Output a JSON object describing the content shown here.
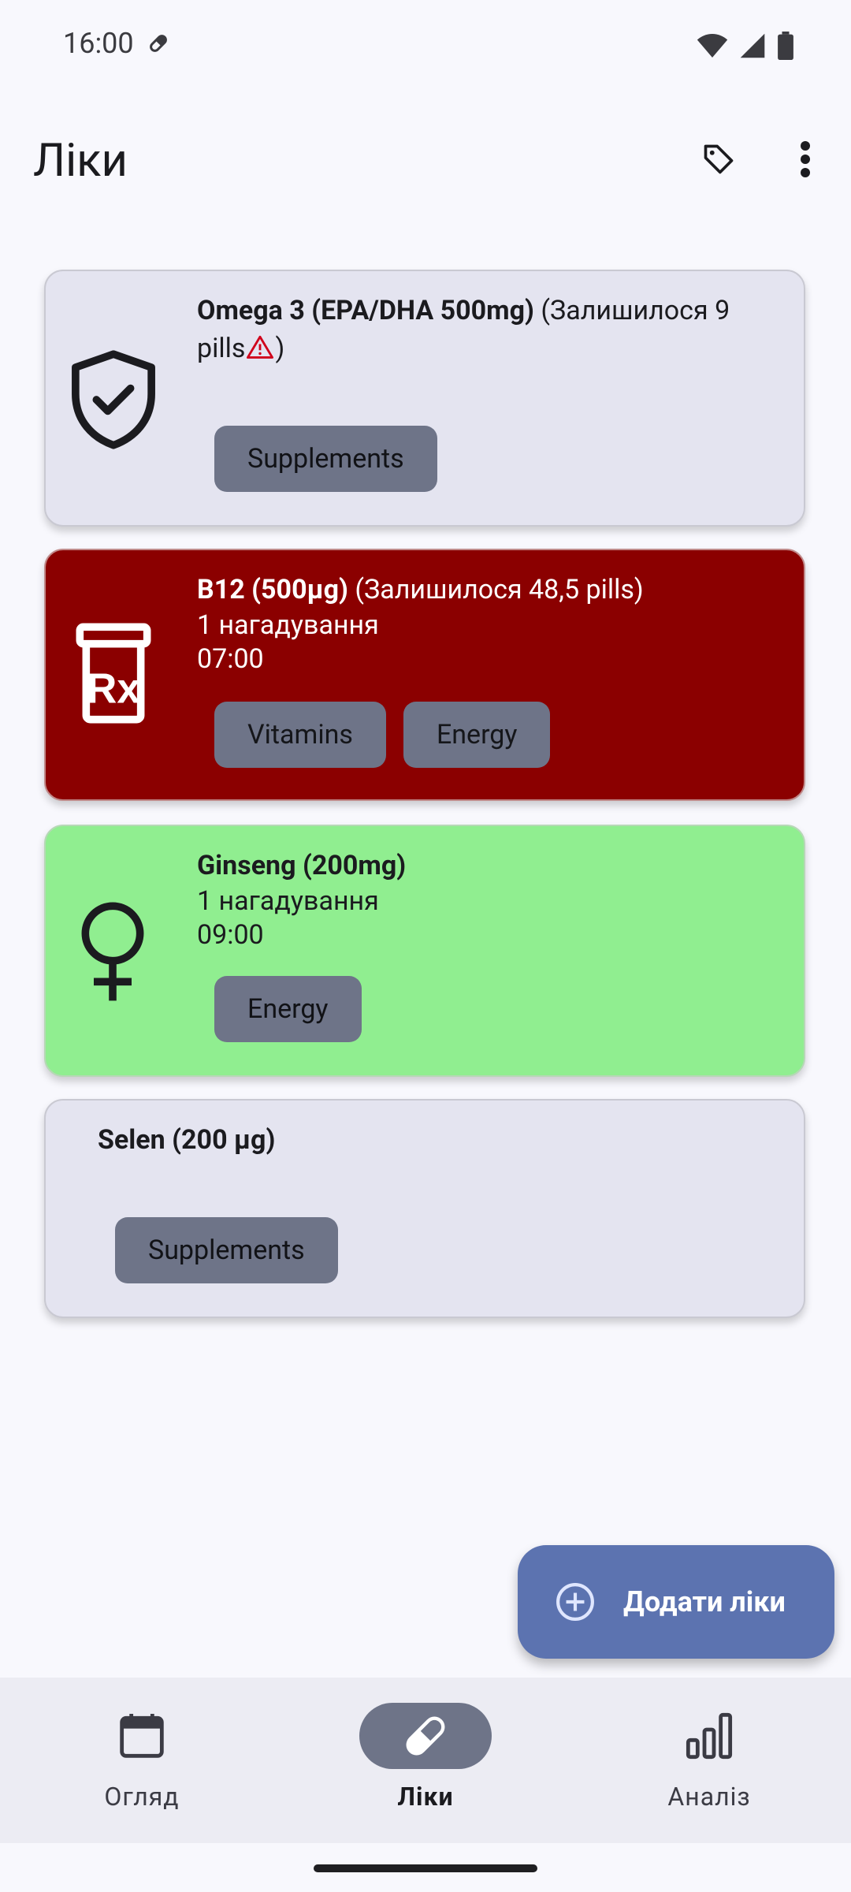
{
  "status_bar": {
    "time": "16:00"
  },
  "app_bar": {
    "title": "Ліки"
  },
  "medicines": [
    {
      "name": "Omega 3 (EPA/DHA 500mg)",
      "stock": "(Залишилося 9",
      "stock_unit": "pills",
      "stock_close": ")",
      "tags": [
        "Supplements"
      ]
    },
    {
      "name": "B12 (500µg)",
      "stock": "(Залишилося 48,5 pills)",
      "reminders": "1 нагадування",
      "time": "07:00",
      "tags": [
        "Vitamins",
        "Energy"
      ]
    },
    {
      "name": "Ginseng (200mg)",
      "reminders": "1 нагадування",
      "time": "09:00",
      "tags": [
        "Energy"
      ]
    },
    {
      "name": "Selen (200 µg)",
      "tags": [
        "Supplements"
      ]
    }
  ],
  "fab": {
    "label": "Додати ліки"
  },
  "bottom_nav": {
    "items": [
      {
        "label": "Огляд",
        "icon": "calendar-icon"
      },
      {
        "label": "Ліки",
        "icon": "pill-icon",
        "active": true
      },
      {
        "label": "Аналіз",
        "icon": "bar-chart-icon"
      }
    ]
  },
  "colors": {
    "background": "#f8f8fd",
    "card_grey": "#e4e4f0",
    "card_red": "#8b0000",
    "card_green": "#90ee90",
    "chip": "#6e7488",
    "fab": "#5c73b0",
    "nav_bg": "#ececf3"
  }
}
